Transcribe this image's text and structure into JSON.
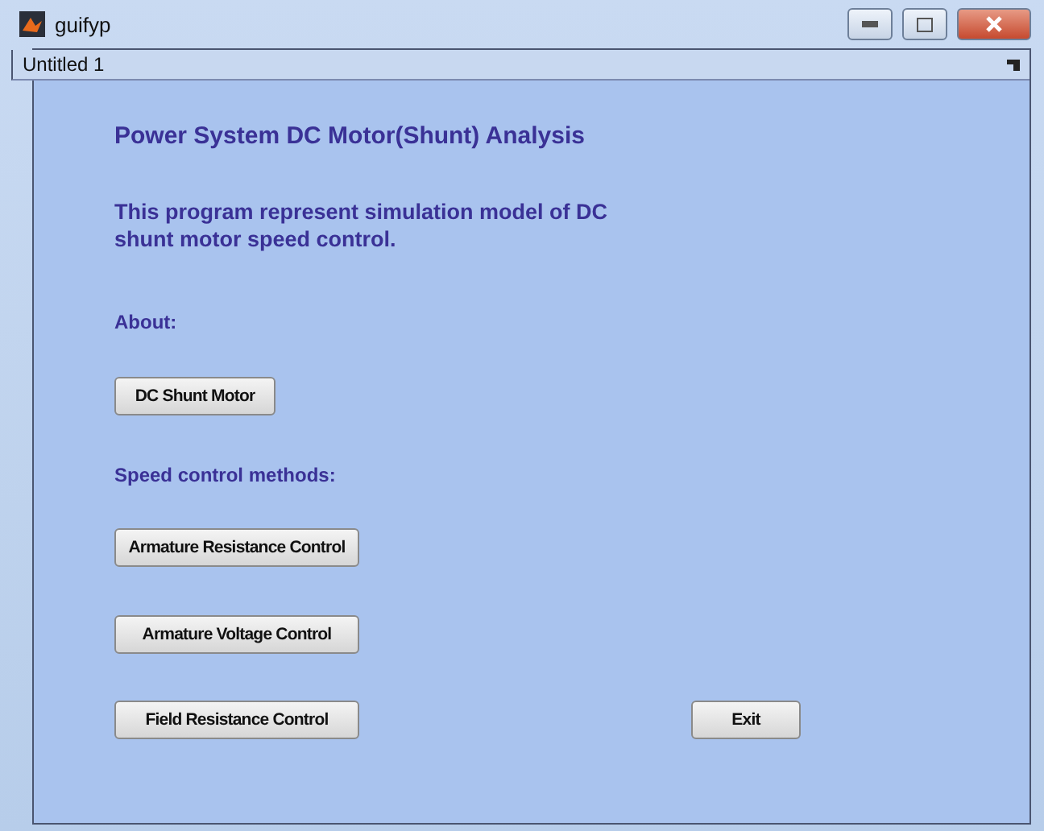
{
  "window": {
    "title": "guifyp"
  },
  "panel": {
    "title": "Untitled 1"
  },
  "heading": "Power System DC Motor(Shunt) Analysis",
  "description": "This program represent simulation model of DC shunt motor speed control.",
  "about": {
    "label": "About:",
    "button": "DC Shunt Motor"
  },
  "speed_control": {
    "label": "Speed control methods:",
    "buttons": [
      "Armature Resistance Control",
      "Armature Voltage Control",
      "Field Resistance Control"
    ]
  },
  "exit_button": "Exit"
}
